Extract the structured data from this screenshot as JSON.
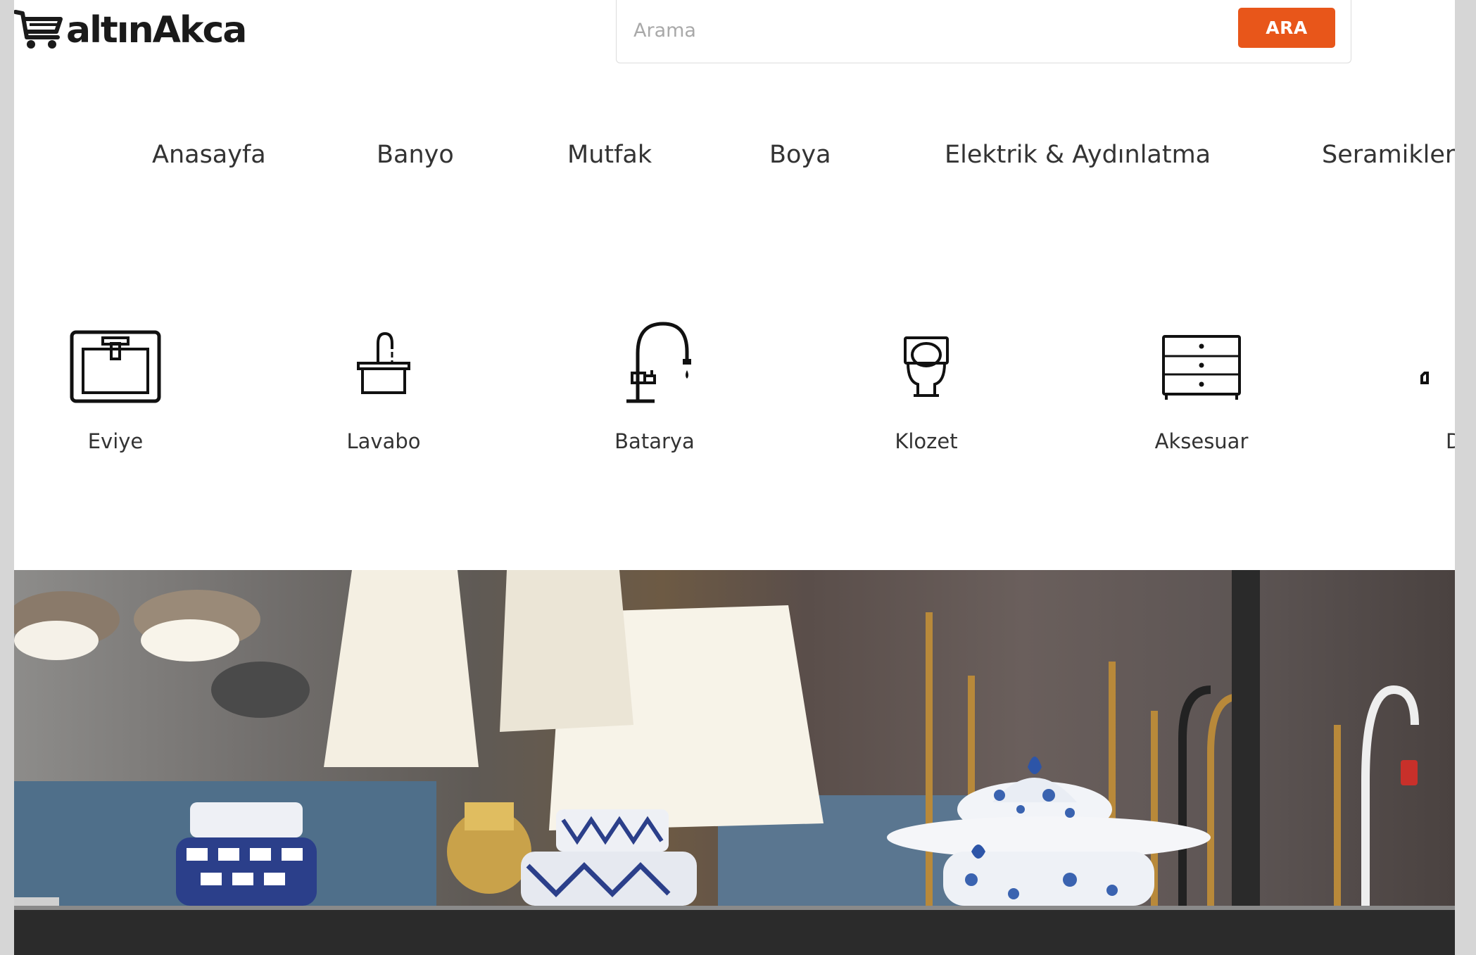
{
  "header": {
    "logo_text": "altınAkca",
    "search": {
      "placeholder": "Arama",
      "value": "",
      "button_label": "ARA"
    }
  },
  "nav": {
    "items": [
      {
        "label": "Anasayfa"
      },
      {
        "label": "Banyo"
      },
      {
        "label": "Mutfak"
      },
      {
        "label": "Boya"
      },
      {
        "label": "Elektrik & Aydınlatma"
      },
      {
        "label": "Seramikler"
      }
    ]
  },
  "categories": {
    "items": [
      {
        "label": "Eviye",
        "icon": "sink-icon"
      },
      {
        "label": "Lavabo",
        "icon": "basin-icon"
      },
      {
        "label": "Batarya",
        "icon": "faucet-icon"
      },
      {
        "label": "Klozet",
        "icon": "toilet-icon"
      },
      {
        "label": "Aksesuar",
        "icon": "cabinet-icon"
      },
      {
        "label": "Da",
        "icon": "partial-icon"
      }
    ]
  },
  "colors": {
    "accent": "#e8561a",
    "text": "#333333",
    "background": "#ffffff",
    "frame": "#d6d6d6"
  }
}
